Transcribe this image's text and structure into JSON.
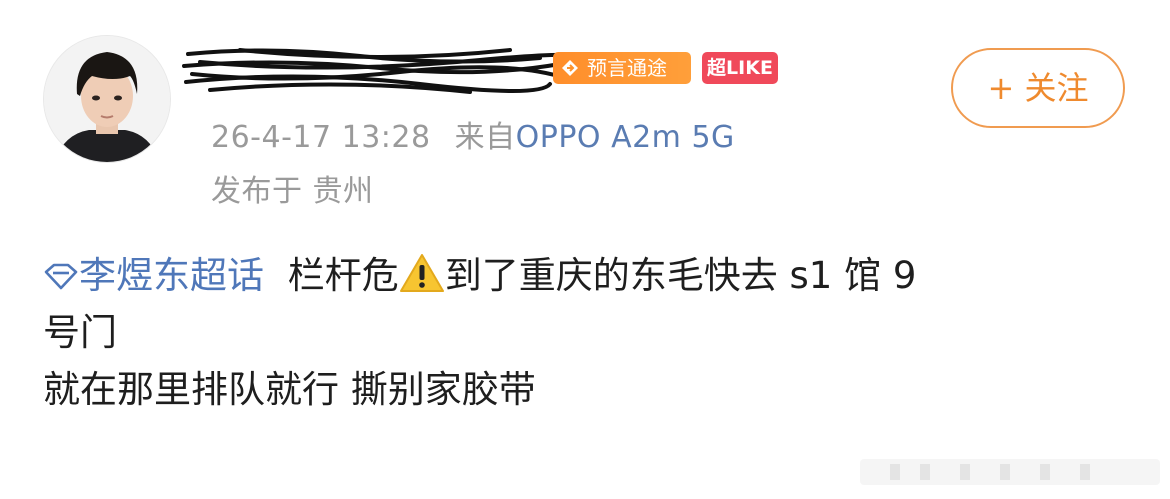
{
  "post": {
    "avatar": {
      "icon": "user-avatar-boy-portrait"
    },
    "username": {
      "redacted": true
    },
    "badges": {
      "prophet": {
        "label": "预言通途",
        "icon": "arrow-right-icon",
        "color": "#ff9229"
      },
      "like": {
        "label": "超LIKE",
        "color": "#f0495a"
      }
    },
    "meta": {
      "time": "26-4-17 13:28",
      "source_prefix": "来自",
      "device": "OPPO A2m 5G",
      "location": "发布于 贵州"
    },
    "follow_button": {
      "label": "+ 关注",
      "color": "#ef8a2e"
    },
    "content": {
      "topic_label": "李煜东超话",
      "line1_part1": "栏杆危",
      "warning_icon": "warning-emoji",
      "line1_part2": "到了重庆的东毛快去 s1 馆 9",
      "line2": "号门",
      "line3": "就在那里排队就行 撕别家胶带"
    }
  },
  "colors": {
    "link_blue": "#4f77b9",
    "meta_gray": "#9a9a9a"
  }
}
